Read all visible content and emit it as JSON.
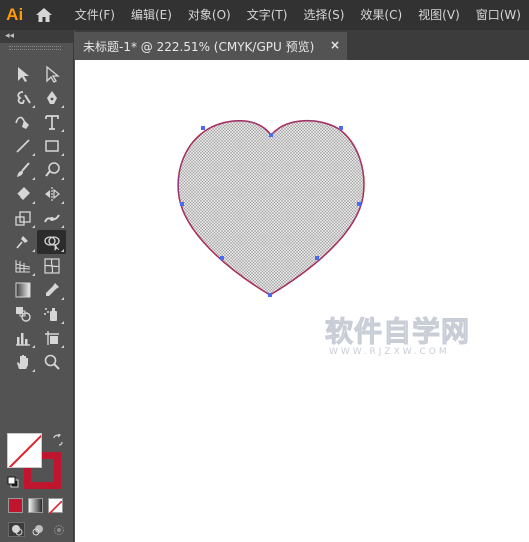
{
  "app": {
    "logo": "Ai",
    "menu": [
      "文件(F)",
      "编辑(E)",
      "对象(O)",
      "文字(T)",
      "选择(S)",
      "效果(C)",
      "视图(V)",
      "窗口(W)"
    ]
  },
  "toolbar": {
    "collapse": "◂◂",
    "tools": [
      {
        "name": "selection-tool",
        "icon": "selection-arrow-icon",
        "active": false
      },
      {
        "name": "direct-selection-tool",
        "icon": "direct-selection-arrow-icon",
        "active": false
      },
      {
        "name": "magic-wand-tool",
        "icon": "magic-wand-icon",
        "active": false
      },
      {
        "name": "pen-tool",
        "icon": "pen-icon",
        "active": false
      },
      {
        "name": "curvature-tool",
        "icon": "curvature-pen-icon",
        "active": false
      },
      {
        "name": "type-tool",
        "icon": "type-icon",
        "active": false
      },
      {
        "name": "line-segment-tool",
        "icon": "line-icon",
        "active": false
      },
      {
        "name": "rectangle-tool",
        "icon": "rectangle-icon",
        "active": false
      },
      {
        "name": "paintbrush-tool",
        "icon": "paintbrush-icon",
        "active": false
      },
      {
        "name": "shaper-tool",
        "icon": "shaper-icon",
        "active": false
      },
      {
        "name": "eraser-tool",
        "icon": "eraser-icon",
        "active": false
      },
      {
        "name": "reflect-tool",
        "icon": "reflect-icon",
        "active": false
      },
      {
        "name": "scale-tool",
        "icon": "scale-icon",
        "active": false
      },
      {
        "name": "width-tool",
        "icon": "width-icon",
        "active": false
      },
      {
        "name": "puppet-warp-tool",
        "icon": "pin-icon",
        "active": false
      },
      {
        "name": "shape-builder-tool",
        "icon": "shape-builder-icon",
        "active": true
      },
      {
        "name": "perspective-grid-tool",
        "icon": "perspective-grid-icon",
        "active": false
      },
      {
        "name": "mesh-tool",
        "icon": "mesh-icon",
        "active": false
      },
      {
        "name": "gradient-tool",
        "icon": "gradient-icon",
        "active": false
      },
      {
        "name": "eyedropper-tool",
        "icon": "eyedropper-icon",
        "active": false
      },
      {
        "name": "blend-tool",
        "icon": "blend-icon",
        "active": false
      },
      {
        "name": "symbol-sprayer-tool",
        "icon": "symbol-sprayer-icon",
        "active": false
      },
      {
        "name": "column-graph-tool",
        "icon": "column-graph-icon",
        "active": false
      },
      {
        "name": "artboard-tool",
        "icon": "artboard-icon",
        "active": false
      },
      {
        "name": "slice-tool",
        "icon": "slice-icon",
        "active": false
      },
      {
        "name": "hand-tool",
        "icon": "hand-icon",
        "active": false
      },
      {
        "name": "zoom-tool",
        "icon": "zoom-icon",
        "active": false
      }
    ]
  },
  "colors": {
    "fill": "#ffffff",
    "stroke": "#c0152f",
    "accent_logo": "#ff9a00",
    "canvas": "#ffffff",
    "ui_dark": "#323232",
    "ui_mid": "#535353"
  },
  "document": {
    "tab_title": "未标题-1* @ 222.51% (CMYK/GPU 预览)",
    "close_glyph": "×"
  },
  "artwork": {
    "shape": "heart",
    "fill_pattern": "gray-crosshatch",
    "stroke_color": "#c0152f",
    "anchor_color": "#4a6cf0"
  },
  "watermark": {
    "main": "软件自学网",
    "url": "WWW.RJZXW.COM"
  }
}
